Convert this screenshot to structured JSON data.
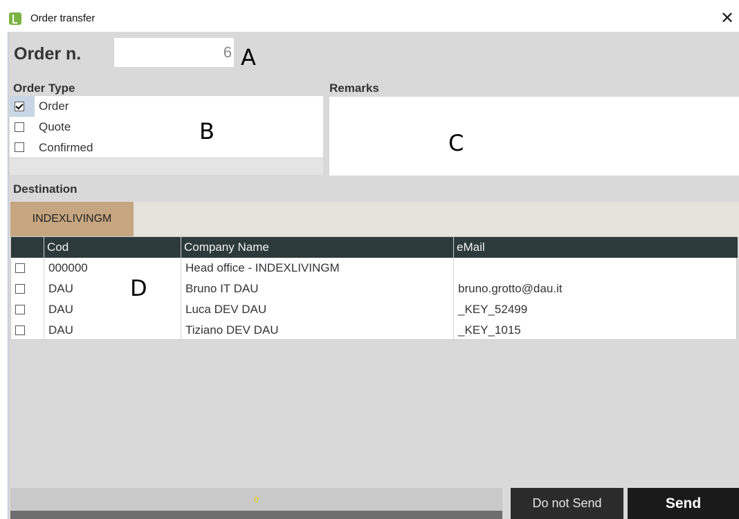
{
  "window": {
    "title": "Order transfer",
    "close_label": "✕"
  },
  "order": {
    "label": "Order n.",
    "value": "6"
  },
  "markers": {
    "a": "A",
    "b": "B",
    "c": "C",
    "d": "D"
  },
  "order_type": {
    "label": "Order Type",
    "options": [
      {
        "label": "Order",
        "checked": true
      },
      {
        "label": "Quote",
        "checked": false
      },
      {
        "label": "Confirmed",
        "checked": false
      }
    ]
  },
  "remarks": {
    "label": "Remarks",
    "value": ""
  },
  "destination": {
    "label": "Destination",
    "tab": "INDEXLIVINGM",
    "columns": [
      "Cod",
      "Company Name",
      "eMail"
    ],
    "rows": [
      {
        "checked": false,
        "cod": "000000",
        "company": "Head office - INDEXLIVINGM",
        "email": ""
      },
      {
        "checked": false,
        "cod": "DAU",
        "company": "Bruno IT DAU",
        "email": "bruno.grotto@dau.it"
      },
      {
        "checked": false,
        "cod": "DAU",
        "company": "Luca DEV DAU",
        "email": "_KEY_52499"
      },
      {
        "checked": false,
        "cod": "DAU",
        "company": "Tiziano DEV DAU",
        "email": "_KEY_1015"
      }
    ]
  },
  "progress": {
    "value": "0"
  },
  "buttons": {
    "do_not_send": "Do not Send",
    "send": "Send"
  },
  "colors": {
    "tab": "#c6a680",
    "header": "#2d3a3c",
    "panel": "#d9d9d9",
    "progress_text": "#e8d200"
  }
}
